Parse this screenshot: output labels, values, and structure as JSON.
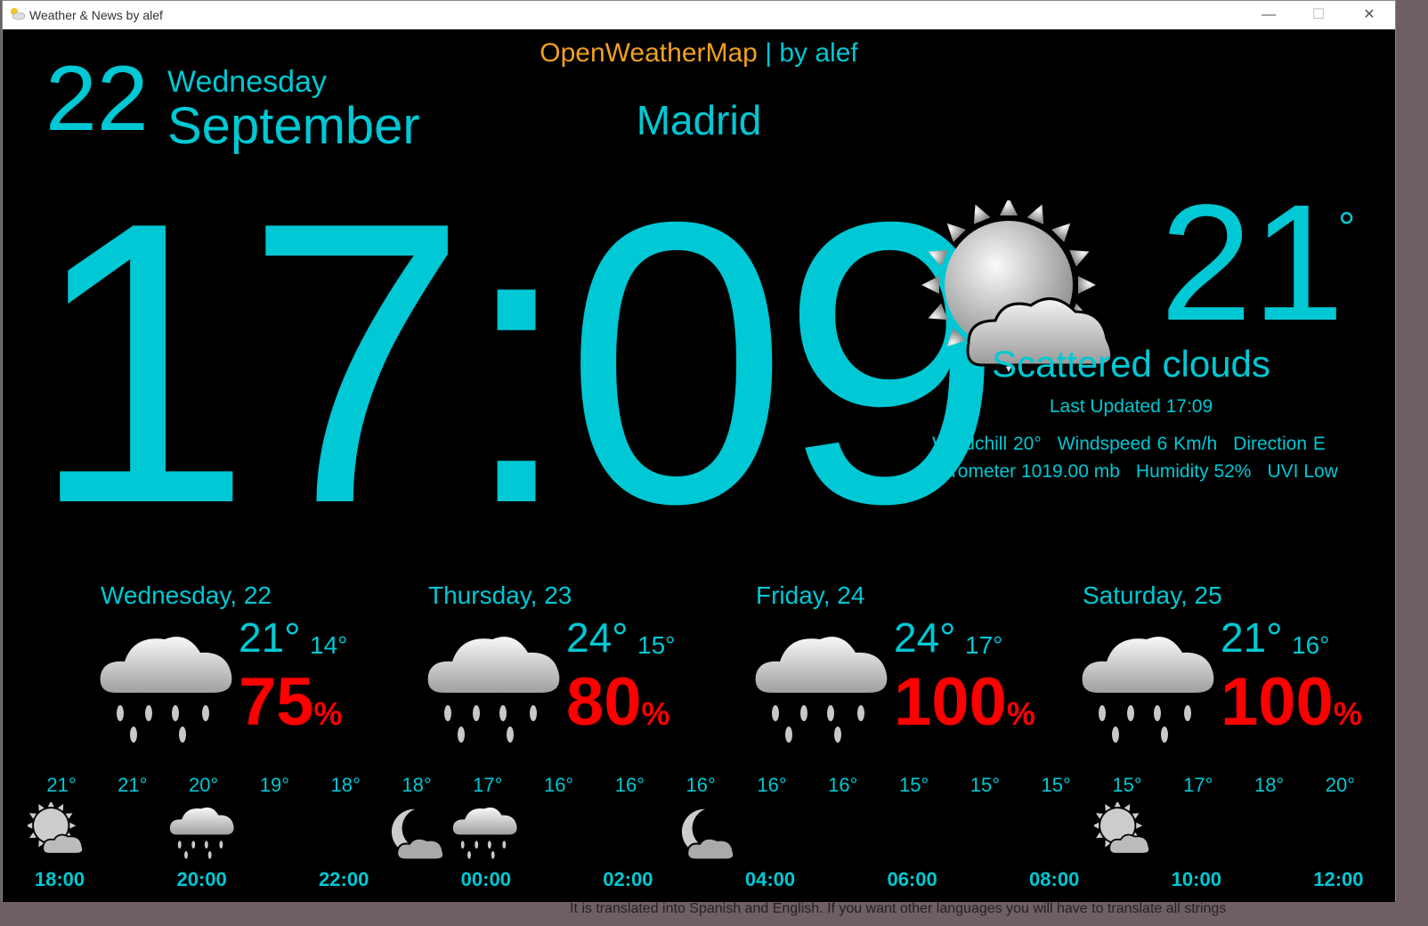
{
  "window": {
    "title": "Weather & News by alef",
    "minimize": "—",
    "maximize": "☐",
    "close": "✕"
  },
  "header": {
    "provider": "OpenWeatherMap",
    "separator": " | ",
    "author": "by alef",
    "city": "Madrid"
  },
  "date": {
    "day": "22",
    "weekday": "Wednesday",
    "month": "September"
  },
  "clock": "17:09",
  "current": {
    "icon": "sun-cloud-icon",
    "temp": "21",
    "deg": "°",
    "condition": "Scattered clouds",
    "last_updated": "Last Updated 17:09",
    "windchill": "Windchill 20°",
    "windspeed": "Windspeed 6 Km/h",
    "direction": "Direction E",
    "barometer": "Barometer 1019.00 mb",
    "humidity": "Humidity 52%",
    "uvi": "UVI Low"
  },
  "forecast": [
    {
      "title": "Wednesday, 22",
      "hi": "21°",
      "lo": "14°",
      "rain": "75",
      "pct": "%",
      "icon": "rain-cloud-icon"
    },
    {
      "title": "Thursday, 23",
      "hi": "24°",
      "lo": "15°",
      "rain": "80",
      "pct": "%",
      "icon": "rain-cloud-icon"
    },
    {
      "title": "Friday, 24",
      "hi": "24°",
      "lo": "17°",
      "rain": "100",
      "pct": "%",
      "icon": "rain-cloud-icon"
    },
    {
      "title": "Saturday, 25",
      "hi": "21°",
      "lo": "16°",
      "rain": "100",
      "pct": "%",
      "icon": "rain-cloud-icon"
    }
  ],
  "hourly_temps": [
    "21°",
    "21°",
    "20°",
    "19°",
    "18°",
    "18°",
    "17°",
    "16°",
    "16°",
    "16°",
    "16°",
    "16°",
    "15°",
    "15°",
    "15°",
    "15°",
    "17°",
    "18°",
    "20°"
  ],
  "hourly_times": [
    "18:00",
    "20:00",
    "22:00",
    "00:00",
    "02:00",
    "04:00",
    "06:00",
    "08:00",
    "10:00",
    "12:00"
  ],
  "hourly_icons": [
    "sun-cloud-icon",
    "rain-cloud-icon",
    "moon-cloud-icon",
    "rain-cloud-icon",
    "moon-cloud-icon",
    "sun-cloud-icon"
  ],
  "taskbar_text": "It is translated into Spanish and English. If you want other languages you will have to translate all strings",
  "colors": {
    "accent": "#00c8d4",
    "rain": "#ff0000",
    "provider": "#f0a020",
    "background": "#000000"
  }
}
